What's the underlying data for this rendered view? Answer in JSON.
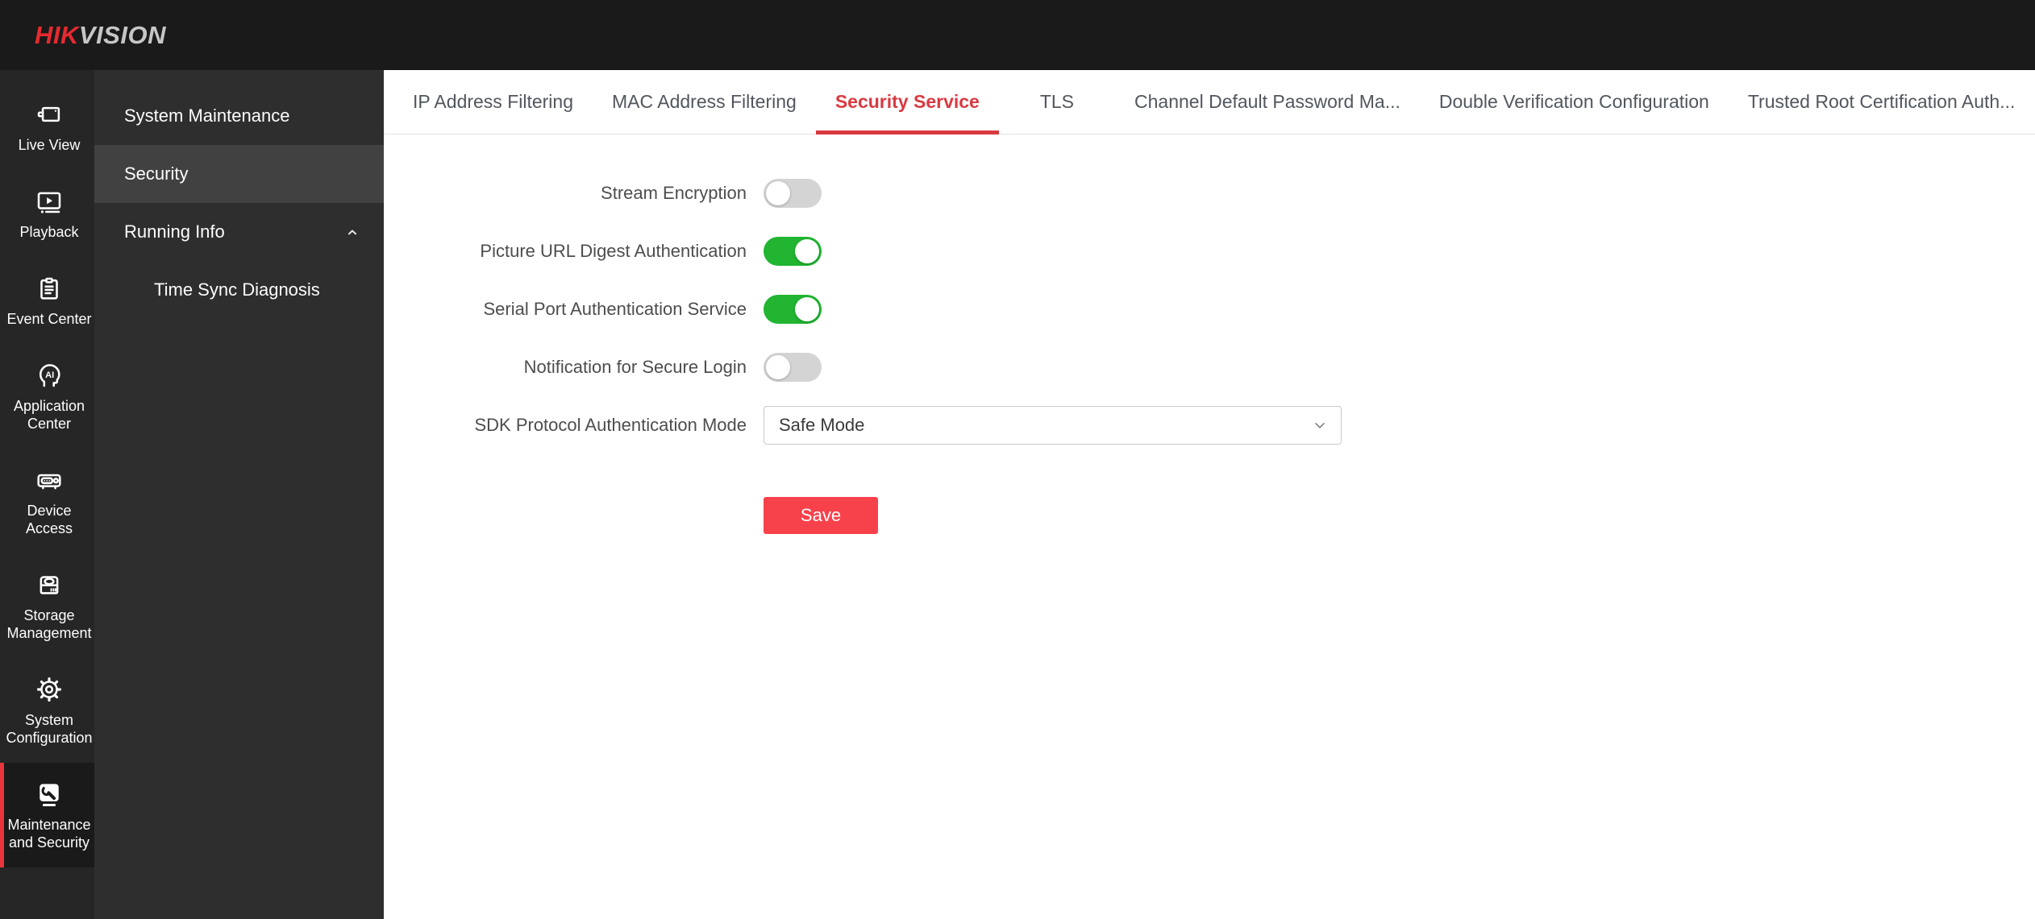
{
  "topbar": {
    "logo_hik": "HIK",
    "logo_vision": "VISION"
  },
  "primary_nav": {
    "active_index": 7,
    "items": [
      {
        "label": "Live View",
        "icon": "live-view-icon"
      },
      {
        "label": "Playback",
        "icon": "playback-icon"
      },
      {
        "label": "Event Center",
        "icon": "event-center-icon"
      },
      {
        "label": "Application Center",
        "icon": "application-center-icon"
      },
      {
        "label": "Device Access",
        "icon": "device-access-icon"
      },
      {
        "label": "Storage Management",
        "icon": "storage-management-icon"
      },
      {
        "label": "System Configuration",
        "icon": "system-configuration-icon"
      },
      {
        "label": "Maintenance and Security",
        "icon": "maintenance-security-icon"
      }
    ]
  },
  "secondary_nav": {
    "active_index": 1,
    "items": [
      {
        "label": "System Maintenance"
      },
      {
        "label": "Security"
      },
      {
        "label": "Running Info",
        "expanded": true
      },
      {
        "label": "Time Sync Diagnosis",
        "child": true
      }
    ]
  },
  "tabs": {
    "active_index": 2,
    "items": [
      {
        "label": "IP Address Filtering"
      },
      {
        "label": "MAC Address Filtering"
      },
      {
        "label": "Security Service"
      },
      {
        "label": "TLS"
      },
      {
        "label": "Channel Default Password Ma..."
      },
      {
        "label": "Double Verification Configuration"
      },
      {
        "label": "Trusted Root Certification Auth..."
      }
    ]
  },
  "form": {
    "toggles": [
      {
        "label": "Stream Encryption",
        "on": false
      },
      {
        "label": "Picture URL Digest Authentication",
        "on": true
      },
      {
        "label": "Serial Port Authentication Service",
        "on": true
      },
      {
        "label": "Notification for Secure Login",
        "on": false
      }
    ],
    "select_row": {
      "label": "SDK Protocol Authentication Mode",
      "value": "Safe Mode"
    },
    "save_label": "Save"
  },
  "colors": {
    "brand_red": "#e52a31",
    "tab_active_red": "#d93a41",
    "save_red": "#f7424b",
    "toggle_on_green": "#21b532",
    "active_item_border_red": "#e8343c",
    "toggle_off_gray": "#d4d4d4"
  }
}
